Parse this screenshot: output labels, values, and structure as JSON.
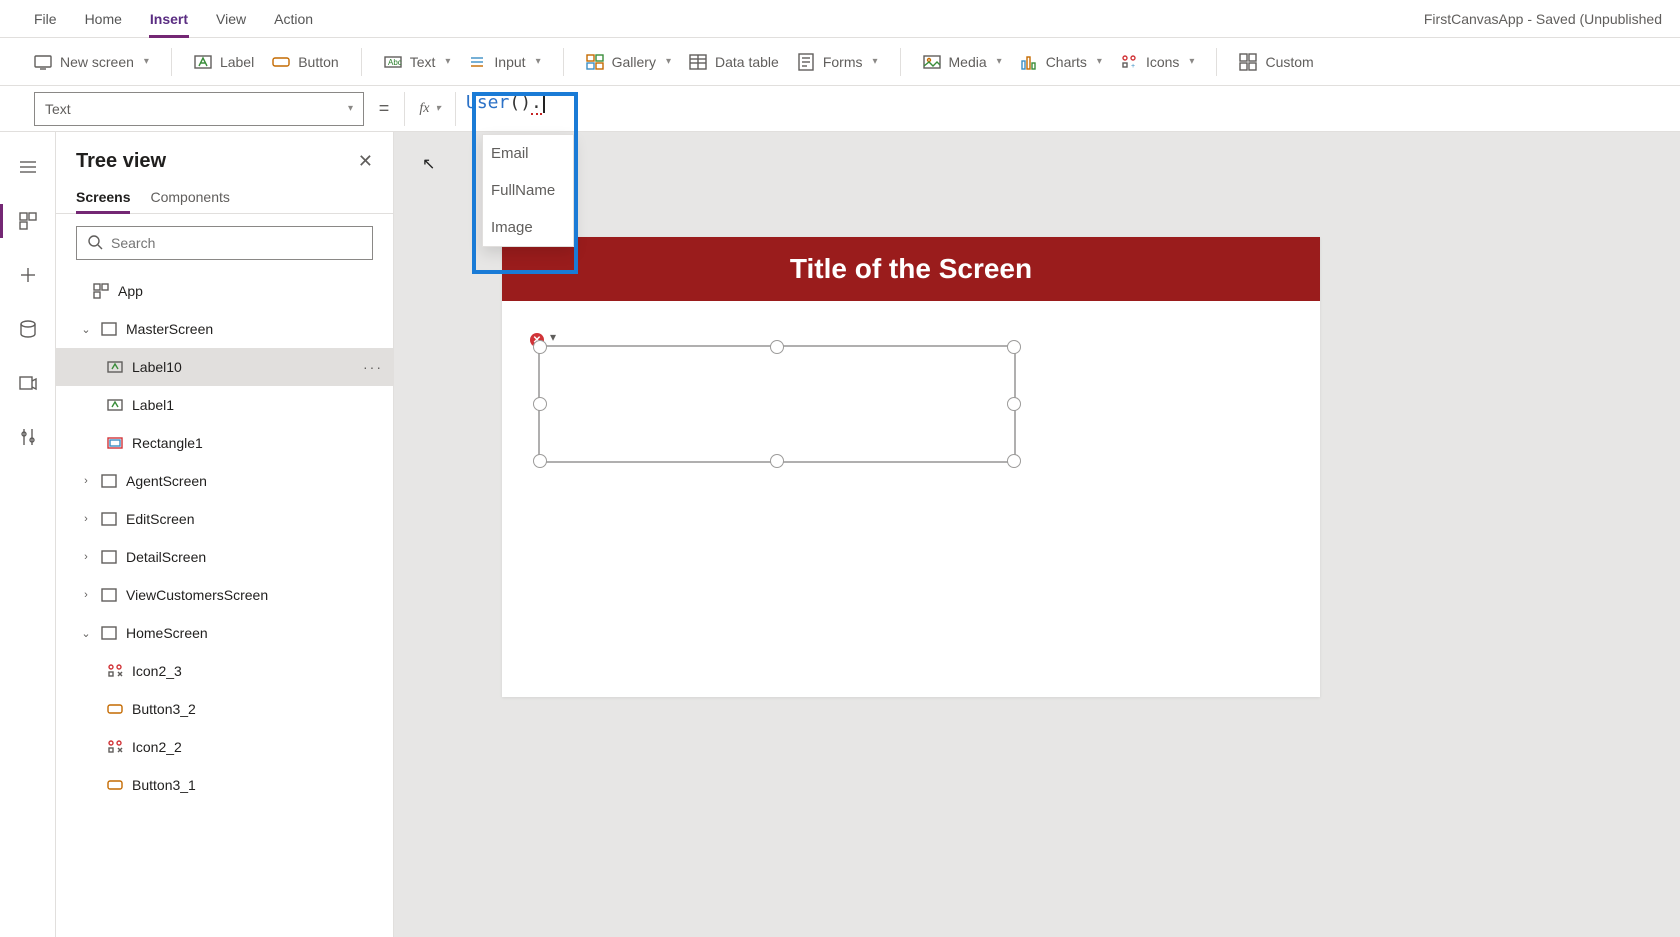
{
  "menu": {
    "items": [
      "File",
      "Home",
      "Insert",
      "View",
      "Action"
    ],
    "active": "Insert",
    "titleRight": "FirstCanvasApp - Saved (Unpublished"
  },
  "ribbon": {
    "newScreen": "New screen",
    "label": "Label",
    "button": "Button",
    "text": "Text",
    "input": "Input",
    "gallery": "Gallery",
    "dataTable": "Data table",
    "forms": "Forms",
    "media": "Media",
    "charts": "Charts",
    "icons": "Icons",
    "custom": "Custom"
  },
  "formula": {
    "property": "Text",
    "fx": "fx",
    "expression": "User().",
    "suggestions": [
      "Email",
      "FullName",
      "Image"
    ]
  },
  "tree": {
    "title": "Tree view",
    "tabs": {
      "screens": "Screens",
      "components": "Components"
    },
    "searchPlaceholder": "Search",
    "app": "App",
    "nodes": {
      "master": "MasterScreen",
      "label10": "Label10",
      "label1": "Label1",
      "rectangle1": "Rectangle1",
      "agent": "AgentScreen",
      "edit": "EditScreen",
      "detail": "DetailScreen",
      "view": "ViewCustomersScreen",
      "home": "HomeScreen",
      "icon2_3": "Icon2_3",
      "button3_2": "Button3_2",
      "icon2_2": "Icon2_2",
      "button3_1": "Button3_1"
    }
  },
  "canvas": {
    "screenTitle": "Title of the Screen"
  }
}
